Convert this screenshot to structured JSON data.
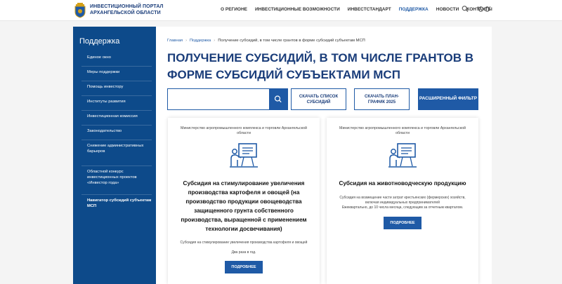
{
  "header": {
    "logo_line1": "ИНВЕСТИЦИОННЫЙ ПОРТАЛ",
    "logo_line2": "АРХАНГЕЛЬСКОЙ ОБЛАСТИ",
    "nav": [
      "О РЕГИОНЕ",
      "ИНВЕСТИЦИОННЫЕ ВОЗМОЖНОСТИ",
      "ИНВЕСТСТАНДАРТ",
      "ПОДДЕРЖКА",
      "НОВОСТИ",
      "КОНТАКТЫ"
    ],
    "active_nav": "ПОДДЕРЖКА",
    "icons": [
      "search-icon",
      "glasses-icon"
    ]
  },
  "sidebar": {
    "title": "Поддержка",
    "items": [
      {
        "label": "Единое окно"
      },
      {
        "label": "Меры поддержки"
      },
      {
        "label": "Помощь инвестору"
      },
      {
        "label": "Институты развития"
      },
      {
        "label": "Инвестиционная комиссия"
      },
      {
        "label": "Законодательство"
      },
      {
        "label": "Снижение административных барьеров"
      },
      {
        "label": "Областной конкурс инвестиционных проектов «Инвестор года»"
      },
      {
        "label": "Навигатор субсидий субъектам МСП"
      }
    ]
  },
  "breadcrumbs": {
    "home": "Главная",
    "section": "Поддержка",
    "current": "Получение субсидий, в том числе грантов в форме субсидий субъектам МСП"
  },
  "page": {
    "title": "ПОЛУЧЕНИЕ СУБСИДИЙ, В ТОМ ЧИСЛЕ ГРАНТОВ В ФОРМЕ СУБСИДИЙ СУБЪЕКТАМИ МСП"
  },
  "toolbar": {
    "search_value": "",
    "btn_list": "СКАЧАТЬ СПИСОК СУБСИДИЙ",
    "btn_plan": "СКАЧАТЬ ПЛАН-ГРАФИК 2025",
    "btn_filter": "РАСШИРЕННЫЙ ФИЛЬТР"
  },
  "cards": [
    {
      "ministry": "Министерство агропромышленного комплекса и торговли Архангельской области",
      "title": "Субсидия на стимулирование увеличения производства картофеля и овощей (на производство продукции овощеводства защищенного грунта собственного производства, выращенной с применением технологии досвечивания)",
      "desc1": "Субсидия на стимулирование увеличения производства картофеля и овощей",
      "desc2": "Два раза в год.",
      "button": "ПОДРОБНЕЕ",
      "icon": "presentation-icon"
    },
    {
      "ministry": "Министерство агропромышленного комплекса и торговли Архангельской области",
      "title": "Субсидия на животноводческую продукцию",
      "desc1": "Субсидия на возмещение части затрат крестьянских (фермерских) хозяйств, включая индивидуальных предпринимателей",
      "desc2": "Ежеквартально, до 10 числа месяца, следующим за отчетным кварталом.",
      "button": "ПОДРОБНЕЕ",
      "icon": "presentation-icon"
    }
  ],
  "colors": {
    "primary": "#1f5aa6",
    "sidebar": "#0d4a8a",
    "title": "#1a3d7a"
  }
}
